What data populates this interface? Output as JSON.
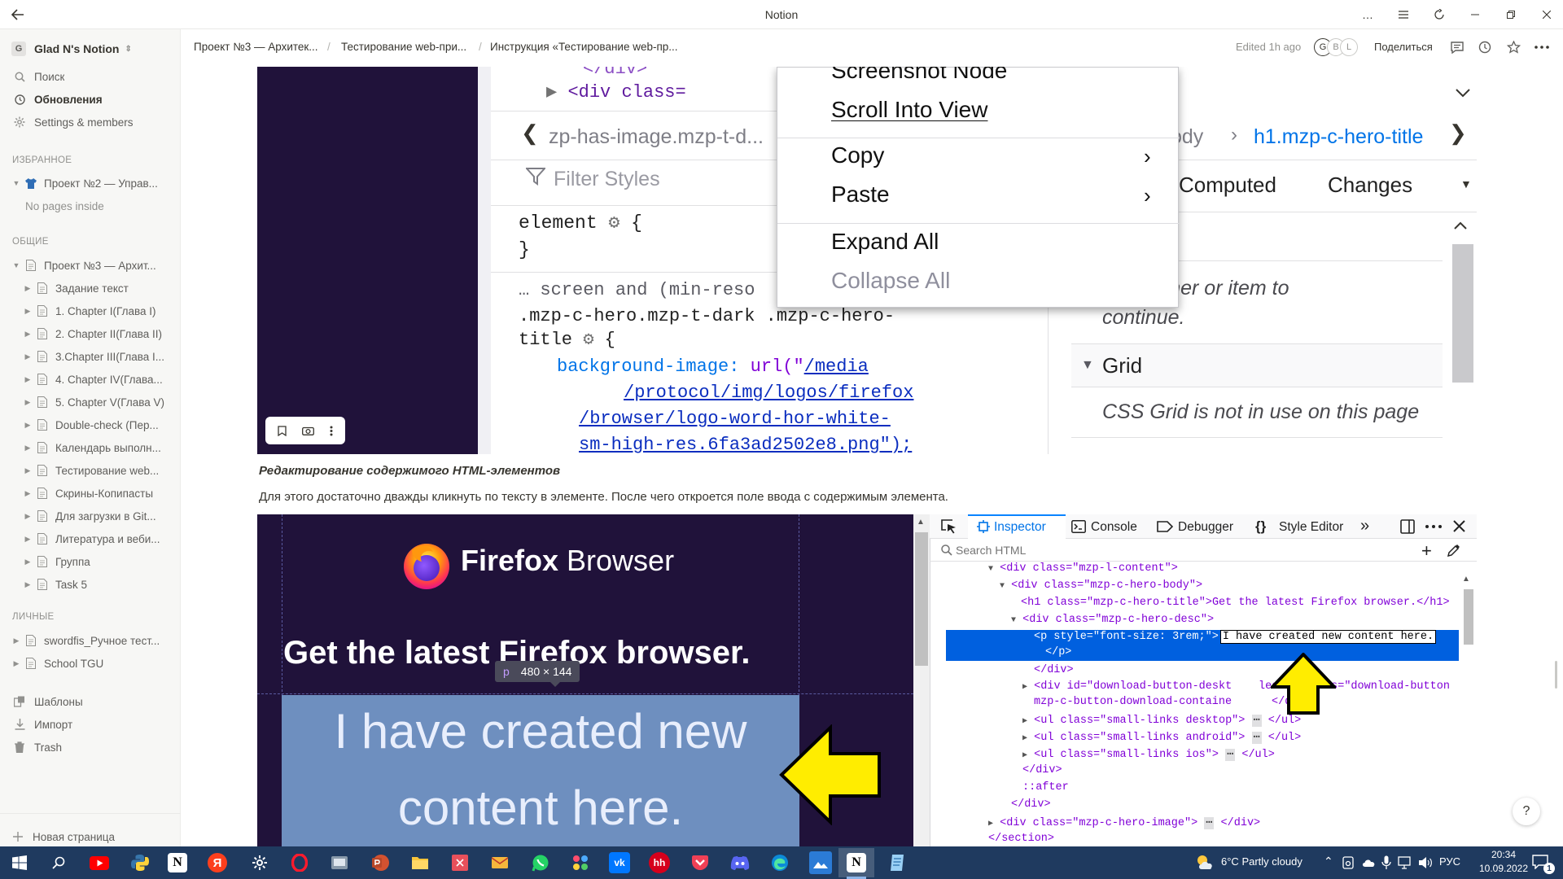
{
  "window": {
    "title": "Notion"
  },
  "sidebar": {
    "workspace": "Glad N's Notion",
    "workspace_initial": "G",
    "top_items": [
      {
        "label": "Поиск",
        "icon": "search-icon"
      },
      {
        "label": "Обновления",
        "icon": "clock-icon"
      },
      {
        "label": "Settings & members",
        "icon": "gear-icon"
      }
    ],
    "favorites_header": "ИЗБРАННОЕ",
    "favorites": [
      {
        "label": "Проект №2 — Управ...",
        "icon": "shirt-icon"
      }
    ],
    "no_pages": "No pages inside",
    "shared_header": "ОБЩИЕ",
    "shared": [
      {
        "label": "Проект №3 — Архит...",
        "level": 0,
        "expanded": true
      },
      {
        "label": "Задание текст",
        "level": 1
      },
      {
        "label": "1. Chapter I(Глава I)",
        "level": 1
      },
      {
        "label": "2. Chapter II(Глава II)",
        "level": 1
      },
      {
        "label": "3.Chapter III(Глава I...",
        "level": 1
      },
      {
        "label": "4. Chapter IV(Глава...",
        "level": 1
      },
      {
        "label": "5. Chapter V(Глава V)",
        "level": 1
      },
      {
        "label": "Double-check (Пер...",
        "level": 1
      },
      {
        "label": "Календарь выполн...",
        "level": 1
      },
      {
        "label": "Тестирование web...",
        "level": 1
      },
      {
        "label": "Скрины-Копипасты",
        "level": 1
      },
      {
        "label": "Для загрузки в Git...",
        "level": 1
      },
      {
        "label": "Литература и веби...",
        "level": 1
      },
      {
        "label": "Группа",
        "level": 1
      },
      {
        "label": "Task 5",
        "level": 1
      }
    ],
    "private_header": "ЛИЧНЫЕ",
    "private": [
      {
        "label": "swordfis_Ручное тест..."
      },
      {
        "label": "School TGU"
      }
    ],
    "bottom_items": [
      {
        "label": "Шаблоны",
        "icon": "templates-icon"
      },
      {
        "label": "Импорт",
        "icon": "import-icon"
      },
      {
        "label": "Trash",
        "icon": "trash-icon"
      }
    ],
    "new_page": "Новая страница"
  },
  "header": {
    "breadcrumbs": [
      "Проект №3 — Архитек...",
      "Тестирование web-при...",
      "Инструкция «Тестирование web-пр..."
    ],
    "edited": "Edited 1h ago",
    "avatars": [
      "G",
      "B",
      "L"
    ],
    "share": "Поделиться"
  },
  "content": {
    "section_title": "Редактирование содержимого HTML-элементов",
    "paragraph": "Для этого достаточно дважды кликнуть по тексту в элементе. После чего откроется поле ввода с содержимым элемента.",
    "shot1": {
      "code_top": "</div>",
      "code_div": "<div class=",
      "breadcrumb_left": "zp-has-image.mzp-t-d...",
      "breadcrumb_body": "ody",
      "breadcrumb_h1": "h1.mzp-c-hero-title",
      "filter": "Filter Styles",
      "element_rule": "element",
      "media_line": "… screen and (min-reso",
      "selector_line1": ".mzp-c-hero.mzp-t-dark .mzp-c-hero-",
      "selector_line2": "title",
      "prop": "background-image:",
      "url_fn": "url(\"",
      "url_lines": [
        "/media",
        "/protocol/img/logos/firefox",
        "/browser/logo-word-hor-white-",
        "sm-high-res.6fa3ad2502e8.png\");"
      ],
      "tabs": [
        "Computed",
        "Changes"
      ],
      "container_text": "ontainer or item to",
      "continue_text": "continue.",
      "grid_label": "Grid",
      "grid_text": "CSS Grid is not in use on this page",
      "menu": [
        "Screenshot Node",
        "Scroll Into View",
        "Copy",
        "Paste",
        "Expand All",
        "Collapse All"
      ]
    },
    "shot2": {
      "brand_bold": "Firefox",
      "brand_light": " Browser",
      "headline": "Get the latest Firefox browser.",
      "tooltip_tag": "p",
      "tooltip_size": "480 × 144",
      "big_text_1": "I have created new",
      "big_text_2": "content here.",
      "devtools_tabs": [
        "Inspector",
        "Console",
        "Debugger",
        "Style Editor"
      ],
      "search_placeholder": "Search HTML",
      "html_lines": [
        "<div class=\"mzp-l-content\">",
        "<div class=\"mzp-c-hero-body\">",
        "<h1 class=\"mzp-c-hero-title\">Get the latest Firefox browser.</h1>",
        "<div class=\"mzp-c-hero-desc\">",
        "<p style=\"font-size: 3rem;\">",
        "I have created new content here.",
        "</p>",
        "</div>",
        "<div id=\"download-button-deskt",
        "lease\" class=\"download-button",
        "mzp-c-button-download-containe",
        "</div>",
        "<ul class=\"small-links desktop\">",
        "</ul>",
        "<ul class=\"small-links android\">",
        "</ul>",
        "<ul class=\"small-links ios\">",
        "</ul>",
        "</div>",
        "::after",
        "</div>",
        "<div class=\"mzp-c-hero-image\">",
        "</div>",
        "</section>"
      ],
      "ellipsis": "⋯"
    },
    "help": "?"
  },
  "taskbar": {
    "weather_temp": "6°C",
    "weather_text": "Partly cloudy",
    "lang": "РУС",
    "time": "20:34",
    "date": "10.09.2022",
    "notif_count": "1"
  },
  "colors": {
    "sidebar_bg": "#f7f7f5",
    "hero_bg": "#20123a",
    "devtools_select": "#0060df",
    "arrow_yellow": "#ffed00",
    "taskbar_bg": "#1f3a5f"
  }
}
